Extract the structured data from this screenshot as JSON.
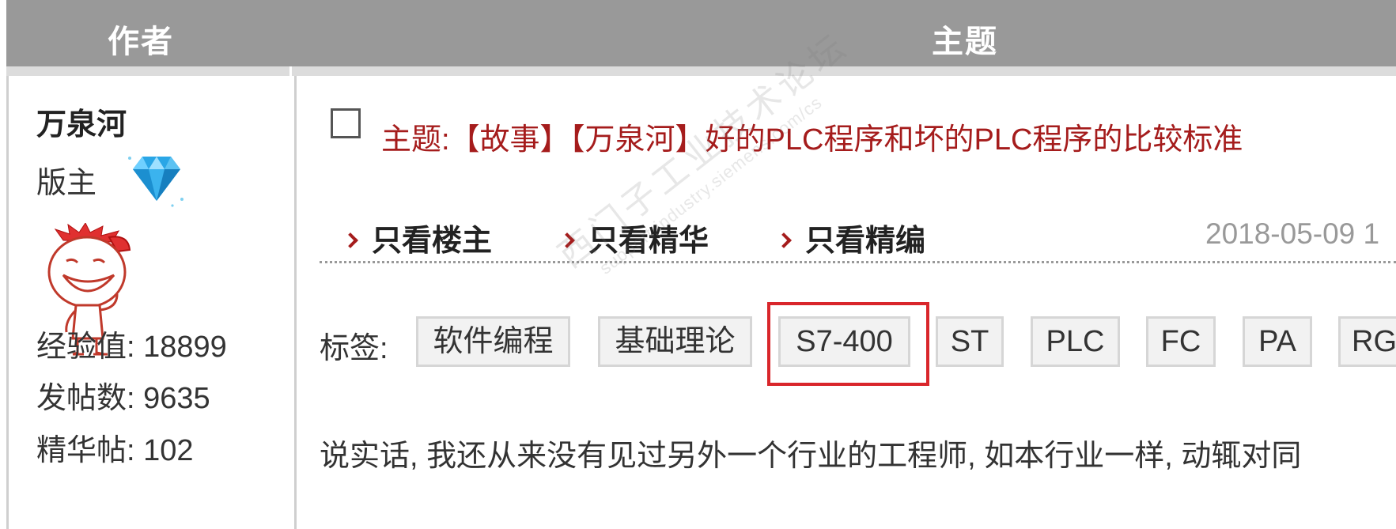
{
  "header": {
    "author_col": "作者",
    "topic_col": "主题"
  },
  "author": {
    "name": "万泉河",
    "role": "版主",
    "rank_icon": "diamond-icon",
    "avatar_icon": "cartoon-avatar",
    "stats": [
      {
        "label": "经验值: 18899"
      },
      {
        "label": "发帖数: 9635"
      },
      {
        "label": "精华帖: 102"
      }
    ]
  },
  "post": {
    "topic": "主题:【故事】【万泉河】好的PLC程序和坏的PLC程序的比较标准",
    "filters": [
      "只看楼主",
      "只看精华",
      "只看精编"
    ],
    "date": "2018-05-09 1",
    "tags_label": "标签:",
    "tags": [
      "软件编程",
      "基础理论",
      "S7-400",
      "ST",
      "PLC",
      "FC",
      "PA",
      "RG"
    ],
    "highlighted_tag": "S7-400",
    "body": "说实话, 我还从来没有见过另外一个行业的工程师, 如本行业一样, 动辄对同"
  },
  "watermark": {
    "main": "西门子工业技术论坛",
    "sub": "support.industry.siemens.com/cs"
  },
  "colors": {
    "header_bg": "#999999",
    "topic_red": "#a51c1c",
    "highlight_red": "#d9262b",
    "tag_bg": "#f2f2f2"
  }
}
